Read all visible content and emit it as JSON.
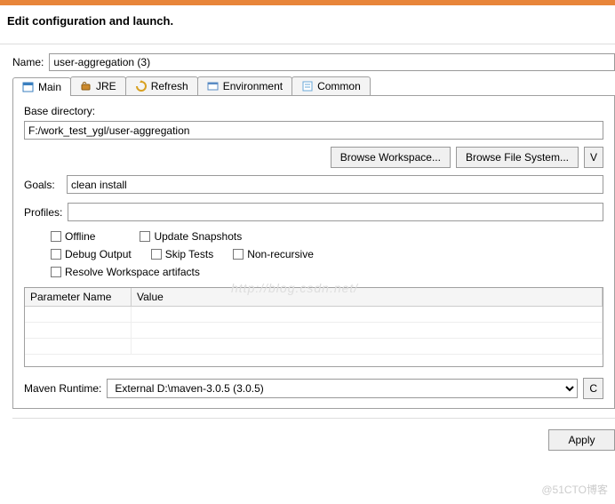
{
  "dialog": {
    "title": "Edit configuration and launch."
  },
  "name": {
    "label": "Name:",
    "value": "user-aggregation (3)"
  },
  "tabs": [
    {
      "label": "Main"
    },
    {
      "label": "JRE"
    },
    {
      "label": "Refresh"
    },
    {
      "label": "Environment"
    },
    {
      "label": "Common"
    }
  ],
  "main": {
    "base_dir_label": "Base directory:",
    "base_dir_value": "F:/work_test_ygl/user-aggregation",
    "browse_workspace": "Browse Workspace...",
    "browse_filesystem": "Browse File System...",
    "variables": "V",
    "goals_label": "Goals:",
    "goals_value": "clean install",
    "profiles_label": "Profiles:",
    "profiles_value": "",
    "checks": {
      "offline": "Offline",
      "update_snapshots": "Update Snapshots",
      "debug_output": "Debug Output",
      "skip_tests": "Skip Tests",
      "non_recursive": "Non-recursive",
      "resolve_workspace": "Resolve Workspace artifacts"
    },
    "table": {
      "col1": "Parameter Name",
      "col2": "Value"
    },
    "maven_runtime_label": "Maven Runtime:",
    "maven_runtime_value": "External D:\\maven-3.0.5 (3.0.5)",
    "configure_btn": "C"
  },
  "footer": {
    "apply": "Apply"
  },
  "watermarks": {
    "url": "http://blog.csdn.net/",
    "brand": "@51CTO博客"
  }
}
